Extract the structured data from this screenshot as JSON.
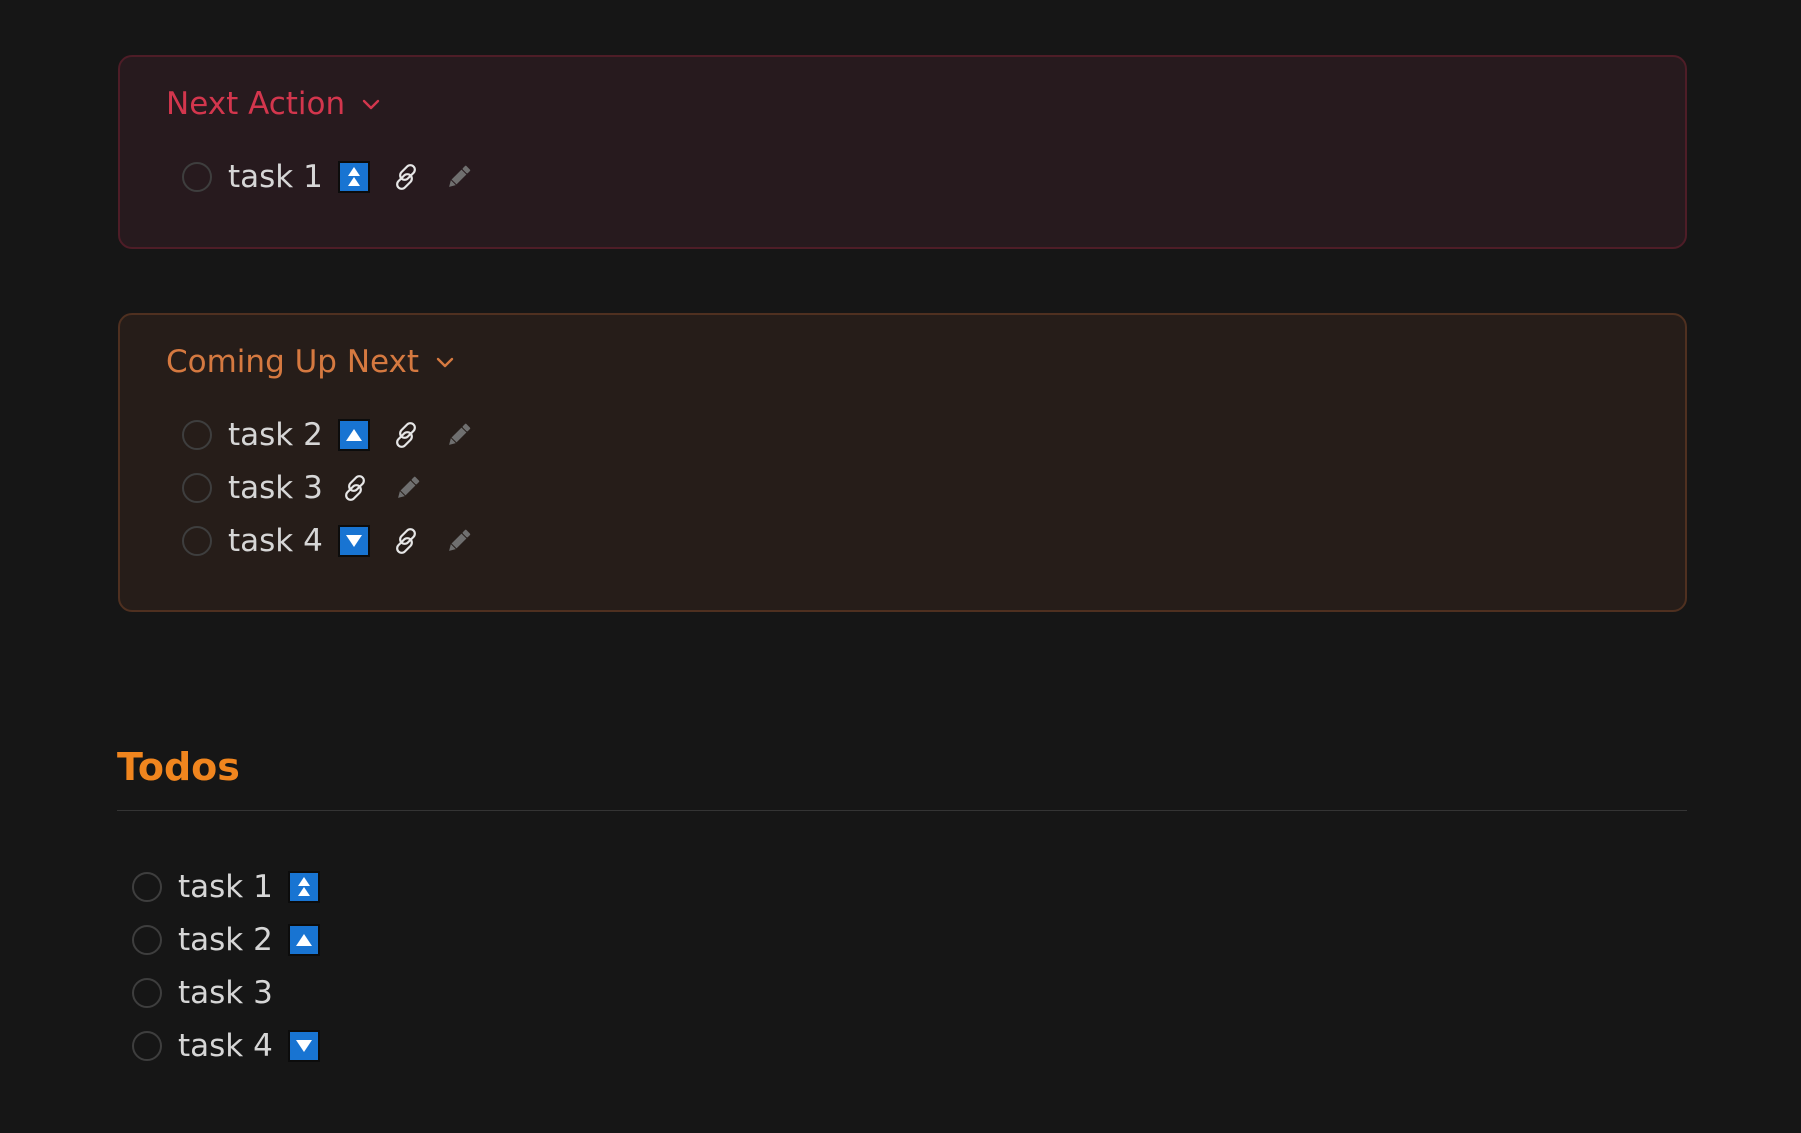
{
  "next_action": {
    "title": "Next Action",
    "accent": "#d3364d",
    "tasks": [
      {
        "text": "task 1",
        "priority": "highest"
      }
    ]
  },
  "coming_up_next": {
    "title": "Coming Up Next",
    "accent": "#d57940",
    "tasks": [
      {
        "text": "task 2",
        "priority": "high"
      },
      {
        "text": "task 3",
        "priority": "none"
      },
      {
        "text": "task 4",
        "priority": "low"
      }
    ]
  },
  "todos": {
    "heading": "Todos",
    "accent": "#f0851e",
    "tasks": [
      {
        "text": "task 1",
        "priority": "highest"
      },
      {
        "text": "task 2",
        "priority": "high"
      },
      {
        "text": "task 3",
        "priority": "none"
      },
      {
        "text": "task 4",
        "priority": "low"
      }
    ]
  },
  "icons": {
    "priority_highest": "double-up-arrow-icon",
    "priority_high": "up-triangle-icon",
    "priority_low": "down-triangle-icon",
    "link": "link-icon",
    "edit": "pencil-icon",
    "collapse": "chevron-down-icon"
  },
  "colors": {
    "background": "#161616",
    "priority_badge": "#1874d2",
    "task_text": "#d6d6d6"
  }
}
